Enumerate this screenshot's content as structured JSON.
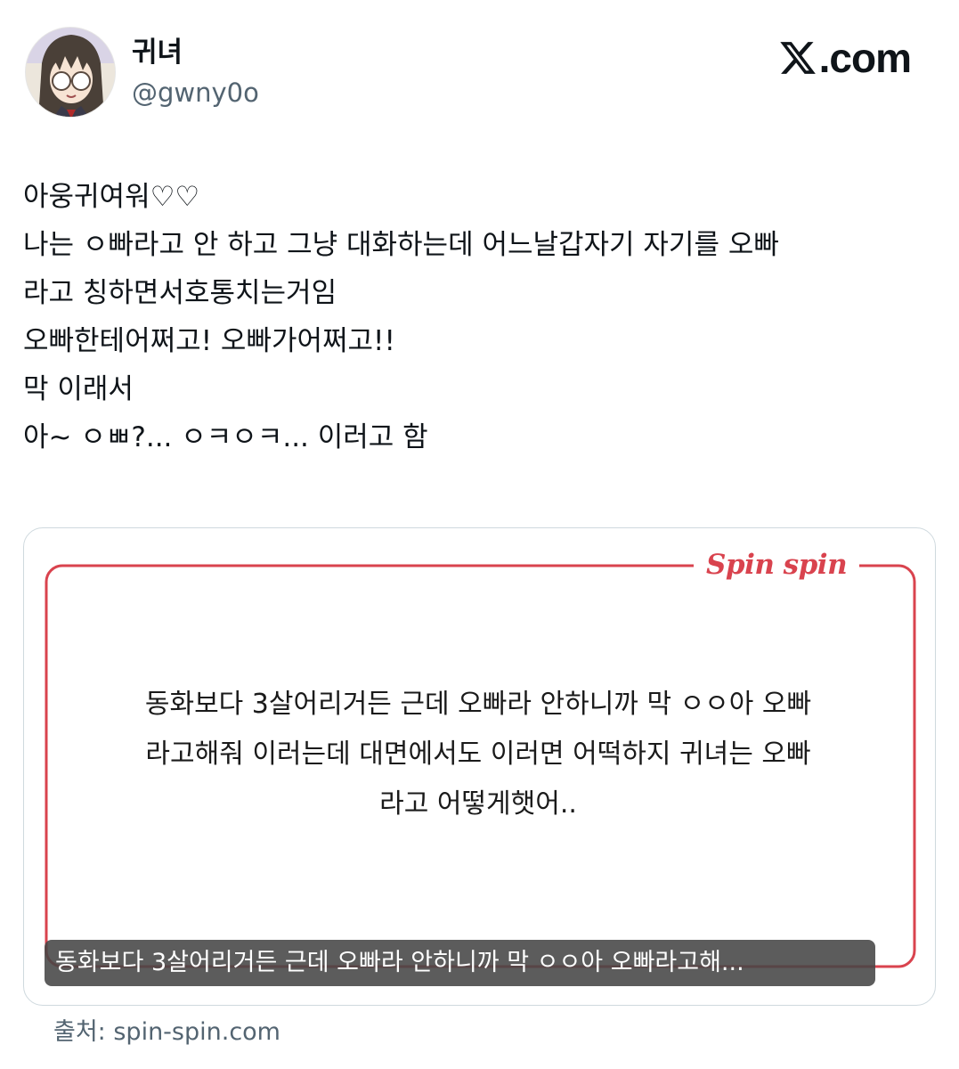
{
  "author": {
    "display_name": "귀녀",
    "handle": "@gwny0o"
  },
  "brand": {
    "logo_icon": "x-logo-icon",
    "domain": ".com"
  },
  "tweet": {
    "lines": [
      "아웅귀여워♡♡",
      "나는 ㅇ빠라고 안 하고 그냥 대화하는데 어느날갑자기 자기를 오빠",
      "라고 칭하면서호통치는거임",
      "오빠한테어쩌고! 오빠가어쩌고!!",
      "막 이래서",
      "아~ ㅇㅃ?... ㅇㅋㅇㅋ... 이러고 함"
    ]
  },
  "media": {
    "logo_text": "Spin spin",
    "question_lines": [
      "동화보다 3살어리거든 근데 오빠라 안하니까 막 ㅇㅇ아 오빠",
      "라고해줘 이러는데 대면에서도 이러면 어떡하지 귀녀는 오빠",
      "라고 어떻게햇어.."
    ],
    "alt_caption": "동화보다 3살어리거든 근데 오빠라 안하니까 막 ㅇㅇ아 오빠라고해...",
    "frame_color": "#d9434e"
  },
  "source": {
    "text": "출처: spin-spin.com"
  }
}
